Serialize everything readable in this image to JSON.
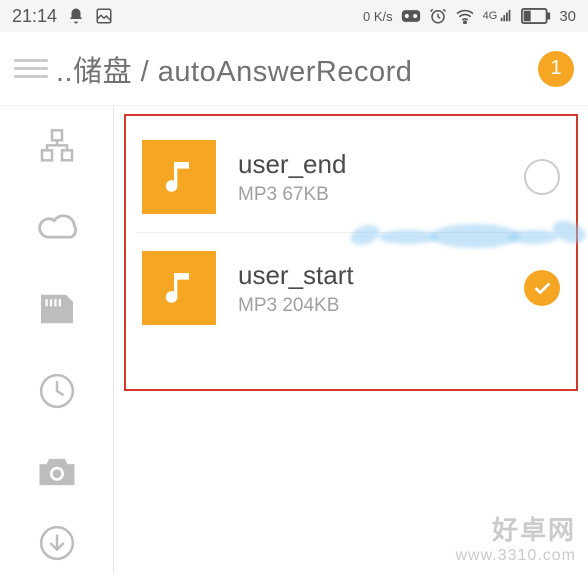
{
  "status": {
    "time": "21:14",
    "data_rate": "0 K/s",
    "signal_label": "4G",
    "battery_text": "30"
  },
  "header": {
    "breadcrumb": "..储盘 / autoAnswerRecord",
    "badge_count": "1"
  },
  "files": [
    {
      "name": "user_end",
      "meta": "MP3 67KB",
      "selected": false
    },
    {
      "name": "user_start",
      "meta": "MP3 204KB",
      "selected": true
    }
  ],
  "watermark": {
    "line1": "好卓网",
    "line2": "www.3310.com"
  }
}
